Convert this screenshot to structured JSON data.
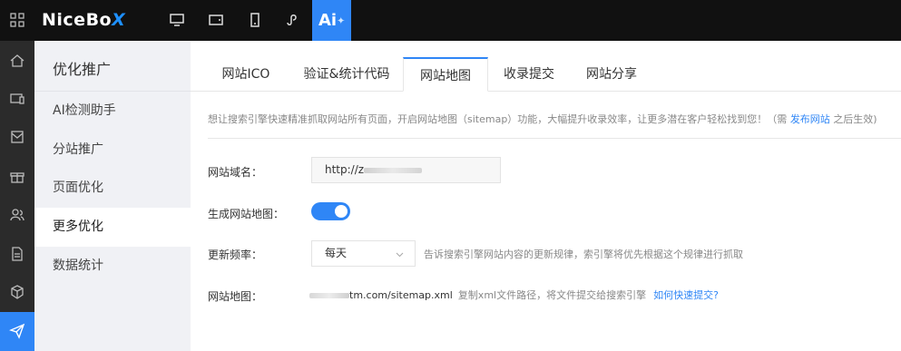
{
  "header": {
    "logo_main": "NiceBo",
    "logo_x": "X",
    "ai_label": "Ai",
    "ai_spark": "✦",
    "icons": [
      "grid-icon",
      "desktop-icon",
      "tablet-landscape-icon",
      "mobile-icon",
      "miniprogram-icon"
    ]
  },
  "rail": {
    "icons": [
      "home-icon",
      "device-icon",
      "mail-icon",
      "gift-icon",
      "users-icon",
      "document-icon",
      "box-icon",
      "send-icon"
    ]
  },
  "submenu": {
    "title": "优化推广",
    "items": [
      {
        "label": "AI检测助手"
      },
      {
        "label": "分站推广"
      },
      {
        "label": "页面优化"
      },
      {
        "label": "更多优化"
      },
      {
        "label": "数据统计"
      }
    ]
  },
  "tabs": [
    {
      "label": "网站ICO"
    },
    {
      "label": "验证&统计代码"
    },
    {
      "label": "网站地图"
    },
    {
      "label": "收录提交"
    },
    {
      "label": "网站分享"
    }
  ],
  "hint": {
    "text": "想让搜索引擎快速精准抓取网站所有页面，开启网站地图（sitemap）功能，大幅提升收录效率，让更多潜在客户轻松找到您！（需",
    "link": "发布网站",
    "suffix": "之后生效)"
  },
  "form": {
    "domain_label": "网站域名：",
    "domain_value": "http://z",
    "generate_label": "生成网站地图：",
    "frequency_label": "更新频率：",
    "frequency_value": "每天",
    "frequency_note": "告诉搜索引擎网站内容的更新规律，索引擎将优先根据这个规律进行抓取",
    "sitemap_label": "网站地图：",
    "sitemap_value": "tm.com/sitemap.xml",
    "sitemap_copy": "复制xml文件路径，将文件提交给搜索引擎",
    "sitemap_link": "如何快速提交?"
  },
  "colors": {
    "accent": "#2f86f6",
    "topbar": "#111111",
    "rail": "#2b2b2b",
    "submenu_bg": "#f0f1f5"
  }
}
